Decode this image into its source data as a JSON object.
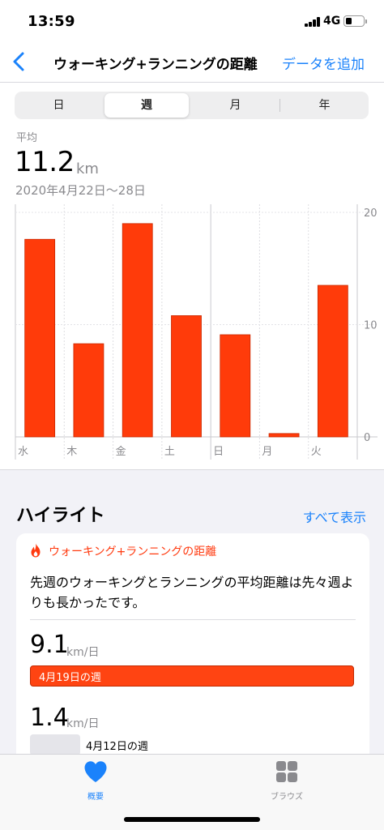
{
  "status_bar": {
    "time": "13:59",
    "network": "4G"
  },
  "nav": {
    "title": "ウォーキング+ランニングの距離",
    "action": "データを追加",
    "back_icon": "chevron-left-icon"
  },
  "segments": {
    "items": [
      "日",
      "週",
      "月",
      "年"
    ],
    "selected": "週"
  },
  "summary": {
    "label": "平均",
    "value": "11.2",
    "unit": "km",
    "date_range": "2020年4月22日〜28日"
  },
  "chart_data": {
    "type": "bar",
    "categories": [
      "水",
      "木",
      "金",
      "土",
      "日",
      "月",
      "火"
    ],
    "values": [
      17.6,
      8.3,
      19.0,
      10.8,
      9.1,
      0.3,
      13.5
    ],
    "ylim": [
      0,
      20
    ],
    "y_ticks": [
      "0",
      "10",
      "20"
    ],
    "bar_color": "#ff3b0a",
    "grid": true,
    "y_axis_position": "right"
  },
  "highlights": {
    "header": "ハイライト",
    "show_all": "すべて表示",
    "card": {
      "category": "ウォーキング+ランニングの距離",
      "category_icon": "flame-icon",
      "text": "先週のウォーキングとランニングの平均距離は先々週よりも長かったです。",
      "current": {
        "value": "9.1",
        "unit": "km/日",
        "label": "4月19日の週"
      },
      "previous": {
        "value": "1.4",
        "unit": "km/日",
        "label": "4月12日の週"
      },
      "accent": "#ff4412"
    }
  },
  "tab_bar": {
    "items": [
      {
        "label": "概要",
        "icon": "heart-icon",
        "active": true
      },
      {
        "label": "ブラウズ",
        "icon": "grid-icon",
        "active": false
      }
    ],
    "active_color": "#1a82fb",
    "inactive_color": "#8a8a8e"
  }
}
